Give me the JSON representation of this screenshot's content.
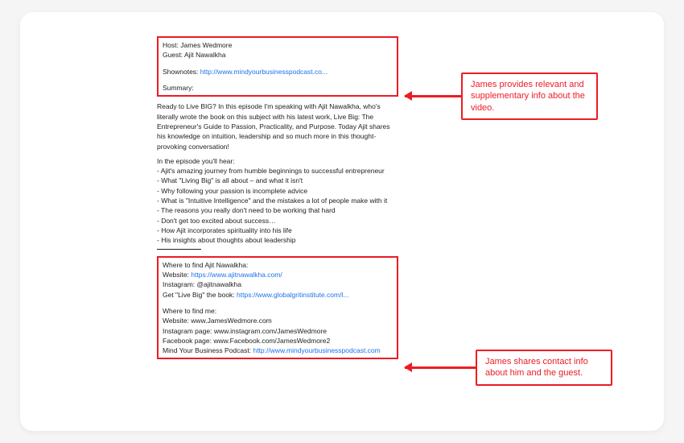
{
  "meta": {
    "host_label": "Host:",
    "host_name": "James Wedmore",
    "guest_label": "Guest:",
    "guest_name": "Ajit Nawalkha",
    "shownotes_label": "Shownotes:",
    "shownotes_link": "http://www.mindyourbusinesspodcast.co...",
    "summary_label": "Summary:"
  },
  "summary_para": "Ready to Live BIG? In this episode I'm speaking with Ajit Nawalkha, who's literally wrote the book on this subject with his latest work, Live Big: The Entrepreneur's Guide to Passion, Practicality, and Purpose. Today Ajit shares his knowledge on intuition, leadership and so much more in this thought-provoking conversation!",
  "bullets_intro": "In the episode you'll hear:",
  "bullets": [
    "- Ajit's amazing journey from humble beginnings to successful entrepreneur",
    "- What \"Living Big\" is all about – and what it isn't",
    "- Why following your passion is incomplete advice",
    "- What is \"Intuitive Intelligence\" and the mistakes a lot of people make with it",
    "- The reasons you really don't need to be working that hard",
    "-  Don't get too excited about success…",
    "- How Ajit incorporates spirituality into his life",
    "- His insights about thoughts about leadership"
  ],
  "contact": {
    "find_guest_label": "Where to find Ajit Nawalkha:",
    "guest_site_label": "Website:",
    "guest_site_link": "https://www.ajitnawalkha.com/",
    "guest_ig_label": "Instagram:",
    "guest_ig_handle": "@ajitnawalkha",
    "book_label": "Get \"Live Big\" the book:",
    "book_link": "https://www.globalgritinstitute.com/l...",
    "find_host_label": "Where to find me:",
    "host_site_label": "Website:",
    "host_site": "www.JamesWedmore.com",
    "host_ig_label": "Instagram page:",
    "host_ig": "www.instagram.com/JamesWedmore",
    "host_fb_label": "Facebook page:",
    "host_fb": "www.Facebook.com/JamesWedmore2",
    "podcast_label": "Mind Your Business Podcast:",
    "podcast_link": "http://www.mindyourbusinesspodcast.com"
  },
  "callouts": {
    "c1": "James provides relevant and supplementary info about the video.",
    "c2": "James shares contact info about him and the guest."
  }
}
